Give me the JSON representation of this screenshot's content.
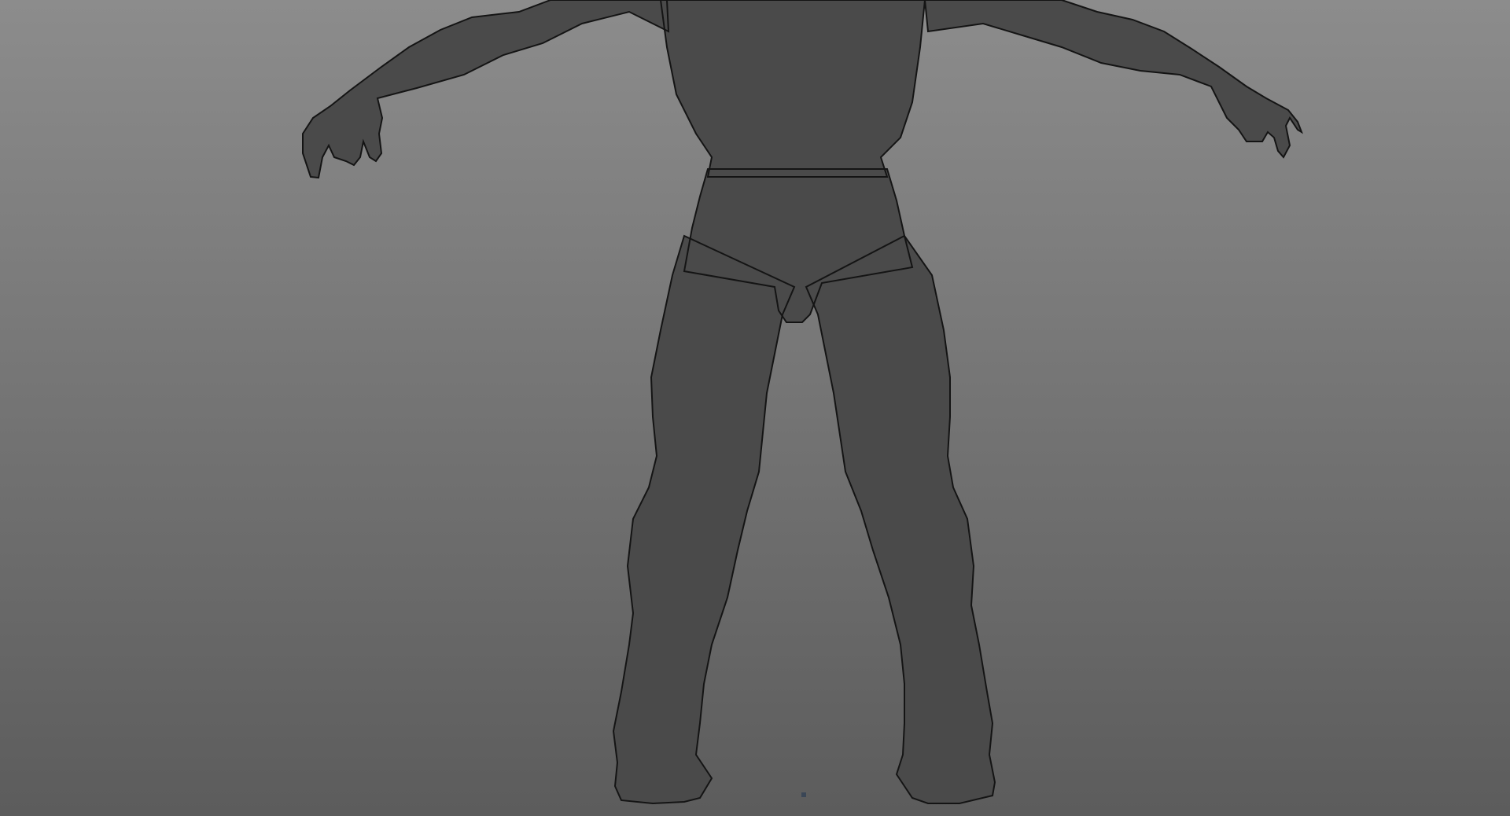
{
  "viewport": {
    "background_top": "#8c8c8c",
    "background_bottom": "#5c5c5c",
    "mesh_fill": "#4a4a4a",
    "wire_color": "#141414",
    "origin_marker_color": "#3a4656"
  },
  "model": {
    "view": "perspective-back",
    "shading": "wireframe-on-shaded"
  }
}
